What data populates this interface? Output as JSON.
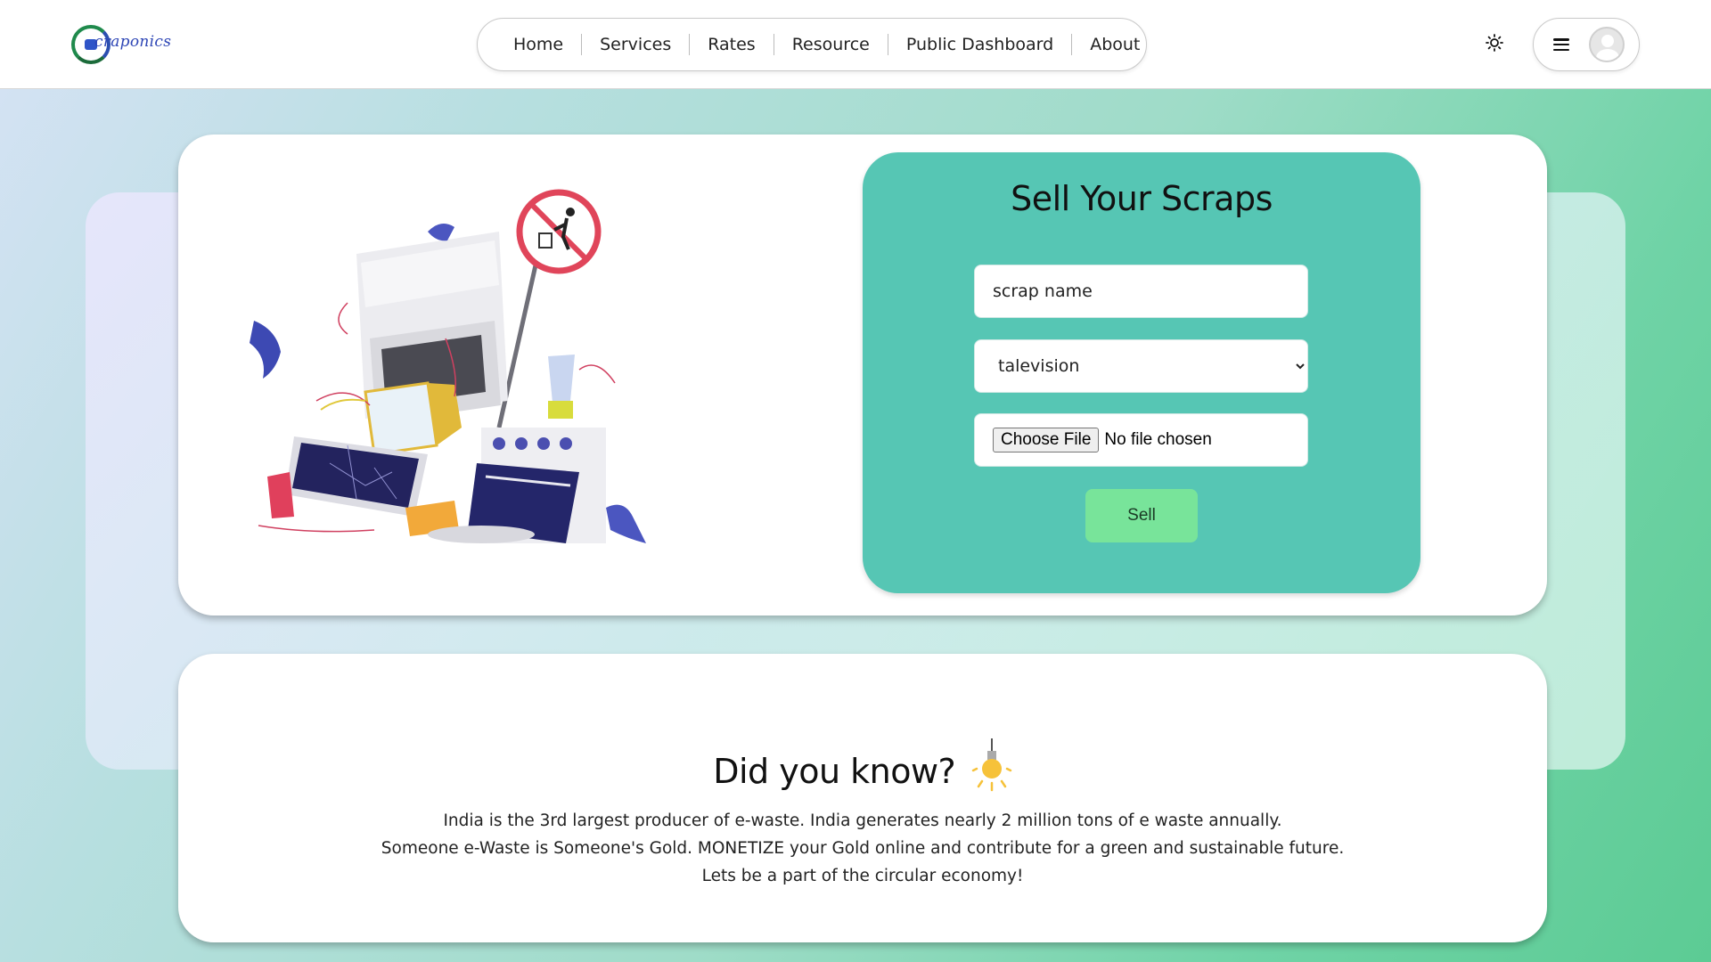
{
  "brand": {
    "logo_text": "craponics"
  },
  "nav": {
    "items": [
      {
        "label": "Home"
      },
      {
        "label": "Services"
      },
      {
        "label": "Rates"
      },
      {
        "label": "Resource"
      },
      {
        "label": "Public Dashboard"
      },
      {
        "label": "About"
      }
    ]
  },
  "header": {
    "theme_icon": "sun-icon",
    "menu_icon": "hamburger-icon",
    "avatar_icon": "user-avatar-icon"
  },
  "sell_form": {
    "title": "Sell Your Scraps",
    "scrap_name_value": "scrap name",
    "category_selected": "talevision",
    "file_button_label": "Choose File",
    "file_status": "No file chosen",
    "submit_label": "Sell"
  },
  "did_you_know": {
    "title": "Did you know?",
    "lines": [
      "India is the 3rd largest producer of e-waste. India generates nearly 2 million tons of e waste annually.",
      "Someone e-Waste is Someone's Gold. MONETIZE your Gold online and contribute for a green and sustainable future.",
      "Lets be a part of the circular economy!"
    ]
  },
  "colors": {
    "form_panel": "#56c6b4",
    "sell_button": "#78e49a",
    "accent_blue": "#2d45b5"
  }
}
